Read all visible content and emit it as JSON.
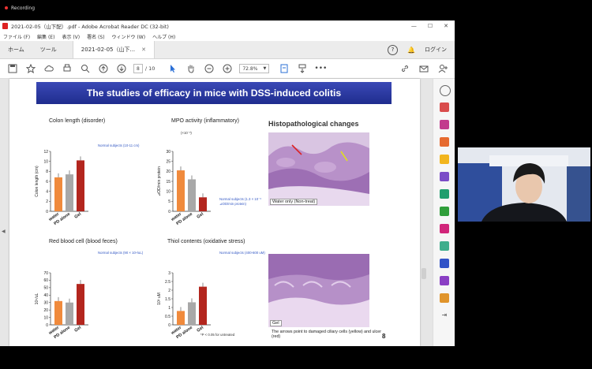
{
  "recording": {
    "label": "Recording"
  },
  "window": {
    "title": "2021-02-05（山下配）.pdf - Adobe Acrobat Reader DC (32-bit)",
    "menu": [
      "ファイル (F)",
      "編集 (E)",
      "表示 (V)",
      "署名 (S)",
      "ウィンドウ (W)",
      "ヘルプ (H)"
    ],
    "tabs": {
      "home": "ホーム",
      "tools": "ツール",
      "doc": "2021-02-05（山下..."
    },
    "help": "?",
    "bell": "🔔",
    "login": "ログイン"
  },
  "toolbar": {
    "page_current": "8",
    "page_total": "/ 10",
    "zoom": "72.8%"
  },
  "slide": {
    "title": "The studies of efficacy in mice with DSS-induced colitis",
    "page_number": "8",
    "colon": {
      "title": "Colon length (disorder)",
      "ylabel": "Colon length (cm)",
      "note": "Normal subjects (10-11 cm)"
    },
    "mpo": {
      "title": "MPO activity (inflammatory)",
      "scale": "(×10⁻³)",
      "ylabel": "⊿OD/min protein",
      "note": "Normal subjects (1.3 × 10⁻³ ⊿OD/min protein)"
    },
    "rbc": {
      "title": "Red blood cell (blood feces)",
      "ylabel": "10⁴/uL",
      "note": "Normal subjects (90 × 10⁴/uL)"
    },
    "thiol": {
      "title": "Thiol contents (oxidative stress)",
      "ylabel": "10³ uM",
      "note": "Normal subjects (400-600 uM)",
      "pnote": "*P < 0.05 for untreated"
    },
    "histo": {
      "title": "Histopathological changes",
      "caption1": "Water only (Non-treat)",
      "caption2": "Gel",
      "footnote": "The arrows point to damaged ciliary cells (yellow) and  ulcer (red)"
    }
  },
  "colors": {
    "water": "#f08a3c",
    "pd": "#a8a8a8",
    "gel": "#b3261e",
    "header": "#2a3aa8"
  },
  "chart_data": [
    {
      "type": "bar",
      "title": "Colon length (disorder)",
      "categories": [
        "water",
        "PD alone",
        "Gel"
      ],
      "values": [
        6.8,
        7.4,
        10.2
      ],
      "ylabel": "Colon length (cm)",
      "ylim": [
        0,
        12
      ],
      "yticks": [
        "0",
        "2",
        "4",
        "6",
        "8",
        "10",
        "12"
      ]
    },
    {
      "type": "bar",
      "title": "MPO activity (inflammatory)",
      "categories": [
        "water",
        "PD alone",
        "Gel"
      ],
      "values": [
        20.5,
        16.0,
        7.0
      ],
      "ylabel": "⊿OD/min protein",
      "ylim": [
        0,
        30
      ],
      "yticks": [
        "0",
        "5",
        "10",
        "15",
        "20",
        "25",
        "30"
      ]
    },
    {
      "type": "bar",
      "title": "Red blood cell (blood feces)",
      "categories": [
        "water",
        "PD alone",
        "Gel"
      ],
      "values": [
        32,
        30,
        55
      ],
      "ylabel": "10⁴/uL",
      "ylim": [
        0,
        70
      ],
      "yticks": [
        "0",
        "10",
        "20",
        "30",
        "40",
        "50",
        "60",
        "70"
      ]
    },
    {
      "type": "bar",
      "title": "Thiol contents (oxidative stress)",
      "categories": [
        "water",
        "PD alone",
        "Gel"
      ],
      "values": [
        0.8,
        1.3,
        2.2
      ],
      "ylabel": "10³ uM",
      "ylim": [
        0,
        3
      ],
      "yticks": [
        "0",
        "0.5",
        "1",
        "1.5",
        "2",
        "2.5",
        "3"
      ]
    }
  ]
}
